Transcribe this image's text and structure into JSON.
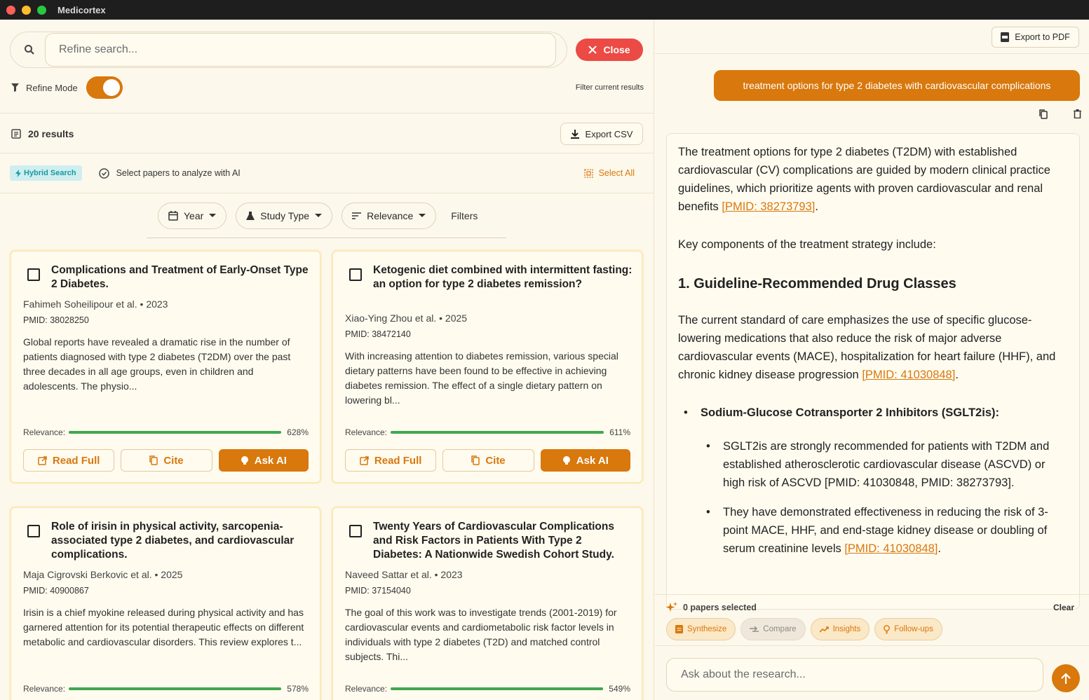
{
  "window": {
    "title": "Medicortex"
  },
  "search": {
    "placeholder": "Refine search...",
    "close_label": "Close"
  },
  "refine": {
    "label": "Refine Mode",
    "enabled": true,
    "hint": "Filter current results"
  },
  "results": {
    "count_label": "20 results",
    "export_label": "Export CSV"
  },
  "mode": {
    "badge": "Hybrid Search",
    "select_hint": "Select papers to analyze with AI",
    "select_all": "Select All"
  },
  "filters": {
    "year": "Year",
    "study_type": "Study Type",
    "sort": "Relevance",
    "more": "Filters"
  },
  "labels": {
    "relevance": "Relevance:",
    "read_full": "Read Full",
    "cite": "Cite",
    "ask_ai": "Ask AI"
  },
  "papers": [
    {
      "title": "Complications and Treatment of Early-Onset Type 2 Diabetes.",
      "meta": "Fahimeh Soheilipour et al. • 2023",
      "pmid": "PMID: 38028250",
      "abstract": "Global reports have revealed a dramatic rise in the number of patients diagnosed with type 2 diabetes (T2DM) over the past three decades in all age groups, even in children and adolescents. The physio...",
      "relevance": "628%",
      "relevance_fill": 1.0
    },
    {
      "title": "Ketogenic diet combined with intermittent fasting: an option for type 2 diabetes remission?",
      "meta": "Xiao-Ying Zhou et al. • 2025",
      "pmid": "PMID: 38472140",
      "abstract": "With increasing attention to diabetes remission, various special dietary patterns have been found to be effective in achieving diabetes remission. The effect of a single dietary pattern on lowering bl...",
      "relevance": "611%",
      "relevance_fill": 1.0
    },
    {
      "title": "Role of irisin in physical activity, sarcopenia-associated type 2 diabetes, and cardiovascular complications.",
      "meta": "Maja Cigrovski Berkovic et al. • 2025",
      "pmid": "PMID: 40900867",
      "abstract": "Irisin is a chief myokine released during physical activity and has garnered attention for its potential therapeutic effects on different metabolic and cardiovascular disorders. This review explores t...",
      "relevance": "578%",
      "relevance_fill": 1.0
    },
    {
      "title": "Twenty Years of Cardiovascular Complications and Risk Factors in Patients With Type 2 Diabetes: A Nationwide Swedish Cohort Study.",
      "meta": "Naveed Sattar et al. • 2023",
      "pmid": "PMID: 37154040",
      "abstract": "The goal of this work was to investigate trends (2001-2019) for cardiovascular events and cardiometabolic risk factor levels in individuals with type 2 diabetes (T2D) and matched control subjects. Thi...",
      "relevance": "549%",
      "relevance_fill": 1.0
    }
  ],
  "chat": {
    "export_pdf": "Export to PDF",
    "query": "treatment options for type 2 diabetes with cardiovascular complications",
    "answer": {
      "p1": "The treatment options for type 2 diabetes (T2DM) with established cardiovascular (CV) complications are guided by modern clinical practice guidelines, which prioritize agents with proven cardiovascular and renal benefits ",
      "p1_cite": "[PMID: 38273793]",
      "p2": "Key components of the treatment strategy include:",
      "h1": "1. Guideline-Recommended Drug Classes",
      "p3": "The current standard of care emphasizes the use of specific glucose-lowering medications that also reduce the risk of major adverse cardiovascular events (MACE), hospitalization for heart failure (HHF), and chronic kidney disease progression ",
      "p3_cite": "[PMID: 41030848]",
      "b1": "Sodium-Glucose Cotransporter 2 Inhibitors (SGLT2is):",
      "b1a": "SGLT2is are strongly recommended for patients with T2DM and established atherosclerotic cardiovascular disease (ASCVD) or high risk of ASCVD [PMID: 41030848, PMID: 38273793].",
      "b1b": "They have demonstrated effectiveness in reducing the risk of 3-point MACE, HHF, and end-stage kidney disease or doubling of serum creatinine levels ",
      "b1b_cite": "[PMID: 41030848]"
    },
    "selected": "0 papers selected",
    "clear": "Clear",
    "actions": {
      "synthesize": "Synthesize",
      "compare": "Compare",
      "insights": "Insights",
      "followups": "Follow-ups"
    },
    "ask_placeholder": "Ask about the research..."
  }
}
